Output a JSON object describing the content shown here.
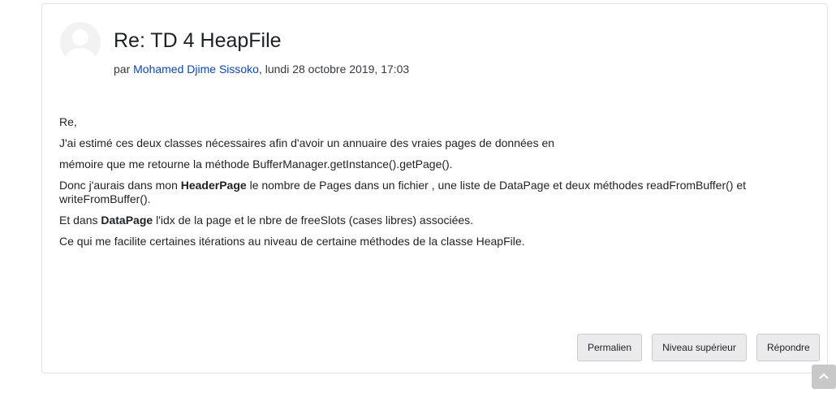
{
  "post": {
    "subject": "Re: TD 4 HeapFile",
    "byline_prefix": "par ",
    "author": "Mohamed Djime Sissoko",
    "byline_suffix": ", lundi 28 octobre 2019, 17:03",
    "avatar_icon": "user-avatar-icon"
  },
  "content": {
    "p1": "Re,",
    "p2": "J'ai estimé ces deux classes nécessaires afin d'avoir un annuaire des vraies pages de données en",
    "p3": "mémoire que me retourne la méthode BufferManager.getInstance().getPage().",
    "p4_before": "Donc j'aurais dans mon ",
    "p4_bold": "HeaderPage",
    "p4_after": " le nombre de Pages dans un fichier , une liste de DataPage et deux méthodes readFromBuffer() et writeFromBuffer().",
    "p5_before": "Et dans ",
    "p5_bold": "DataPage",
    "p5_after": " l'idx de la page et le nbre de freeSlots (cases libres) associées.",
    "p6": "Ce qui me facilite certaines itérations au niveau de certaine méthodes de la classe HeapFile."
  },
  "actions": {
    "permalink": "Permalien",
    "parent": "Niveau supérieur",
    "reply": "Répondre"
  },
  "scroll_top_icon": "chevron-up-icon"
}
